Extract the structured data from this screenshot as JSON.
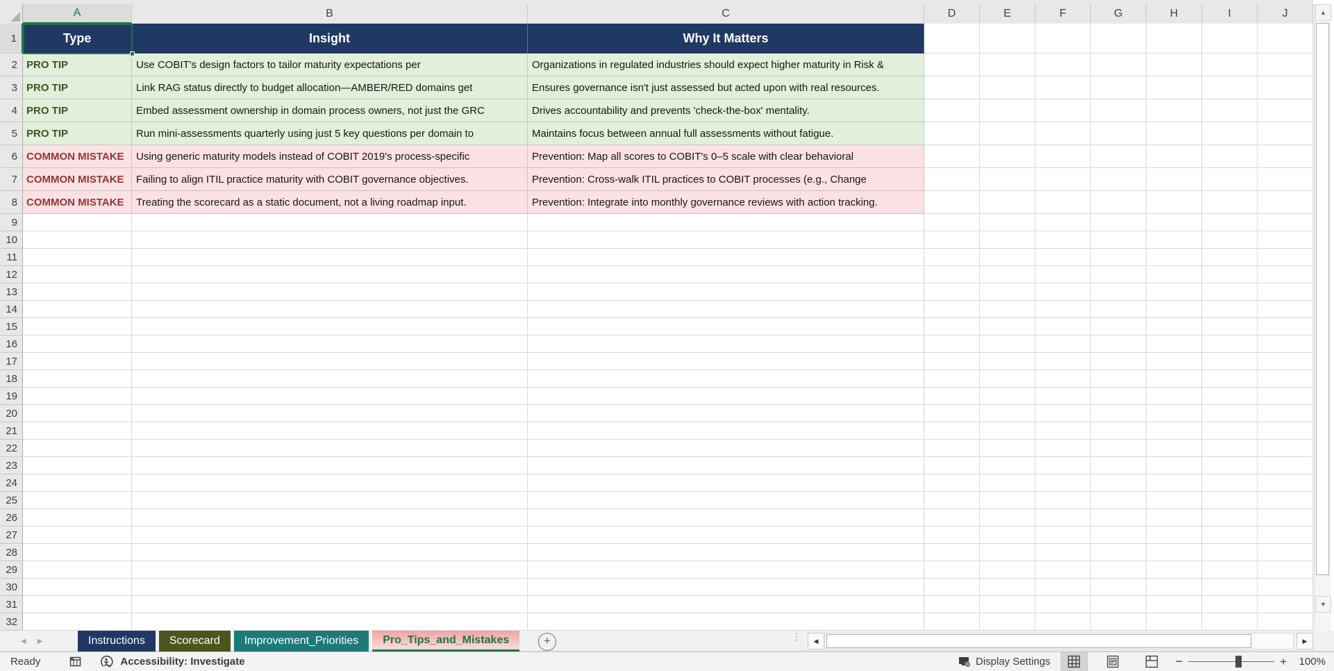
{
  "colors": {
    "navy": "#1F3864",
    "tip_bg": "#E2EFDA",
    "tip_text": "#375623",
    "mistake_bg": "#FBE1E3",
    "mistake_text": "#943634",
    "sel_green": "#217346",
    "hdr_bg": "#E8E8E8",
    "tab_instructions": "#1F3864",
    "tab_scorecard": "#4A561D",
    "tab_improvement": "#1D7A78",
    "tab_active_tint": "#F5B5B3"
  },
  "sheet": {
    "column_letters": [
      "A",
      "B",
      "C",
      "D",
      "E",
      "F",
      "G",
      "H",
      "I",
      "J"
    ],
    "row_numbers": [
      1,
      2,
      3,
      4,
      5,
      6,
      7,
      8,
      9,
      10,
      11,
      12,
      13,
      14,
      15,
      16,
      17,
      18,
      19,
      20,
      21,
      22,
      23,
      24,
      25,
      26,
      27,
      28,
      29,
      30,
      31,
      32
    ],
    "headers": [
      "Type",
      "Insight",
      "Why It Matters"
    ],
    "selected_cell": "A1",
    "rows": [
      {
        "kind": "tip",
        "type": "PRO TIP",
        "insight": "Use COBIT's design factors to tailor maturity expectations per",
        "why": "Organizations in regulated industries should expect higher maturity in Risk &"
      },
      {
        "kind": "tip",
        "type": "PRO TIP",
        "insight": "Link RAG status directly to budget allocation—AMBER/RED domains get",
        "why": "Ensures governance isn't just assessed but acted upon with real resources."
      },
      {
        "kind": "tip",
        "type": "PRO TIP",
        "insight": "Embed assessment ownership in domain process owners, not just the GRC",
        "why": "Drives accountability and prevents 'check-the-box' mentality."
      },
      {
        "kind": "tip",
        "type": "PRO TIP",
        "insight": "Run mini-assessments quarterly using just 5 key questions per domain to",
        "why": "Maintains focus between annual full assessments without fatigue."
      },
      {
        "kind": "mistake",
        "type": "COMMON MISTAKE",
        "insight": "Using generic maturity models instead of COBIT 2019's process-specific",
        "why": "Prevention: Map all scores to COBIT's 0–5 scale with clear behavioral"
      },
      {
        "kind": "mistake",
        "type": "COMMON MISTAKE",
        "insight": "Failing to align ITIL practice maturity with COBIT governance objectives.",
        "why": "Prevention: Cross-walk ITIL practices to COBIT processes (e.g., Change"
      },
      {
        "kind": "mistake",
        "type": "COMMON MISTAKE",
        "insight": "Treating the scorecard as a static document, not a living roadmap input.",
        "why": "Prevention: Integrate into monthly governance reviews with action tracking."
      }
    ]
  },
  "tabs": {
    "items": [
      {
        "label": "Instructions",
        "active": false,
        "color": "#1F3864"
      },
      {
        "label": "Scorecard",
        "active": false,
        "color": "#4A561D"
      },
      {
        "label": "Improvement_Priorities",
        "active": false,
        "color": "#1D7A78"
      },
      {
        "label": "Pro_Tips_and_Mistakes",
        "active": true,
        "color": "#F5B5B3"
      }
    ],
    "add_label": "+"
  },
  "status_bar": {
    "ready": "Ready",
    "accessibility": "Accessibility: Investigate",
    "display_settings": "Display Settings",
    "zoom_level": "100%"
  }
}
